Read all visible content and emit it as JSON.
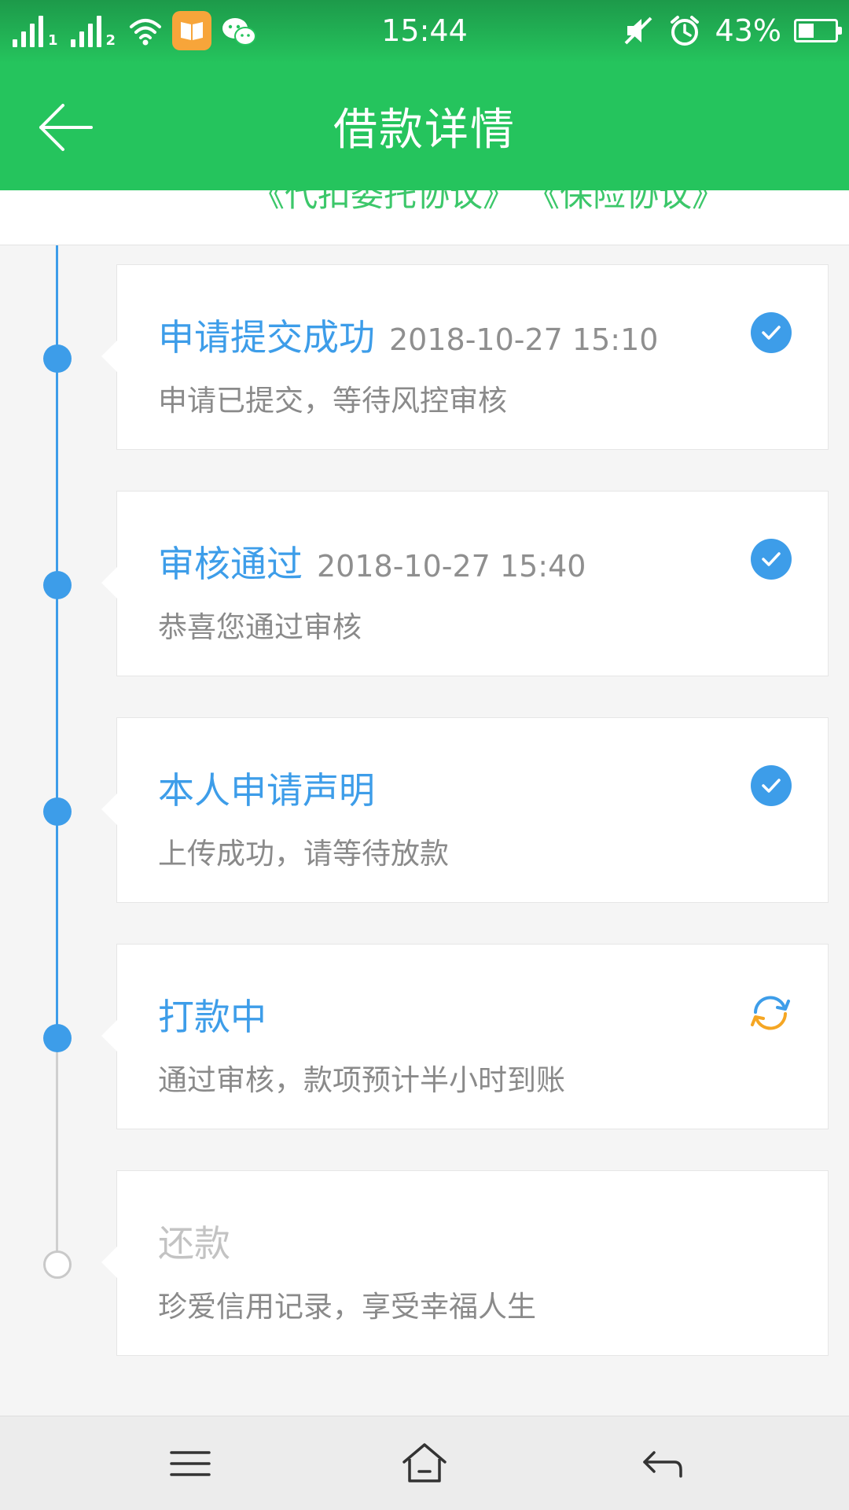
{
  "status_bar": {
    "sim1": "1",
    "sim2": "2",
    "time": "15:44",
    "battery_percent": "43%",
    "battery_level": 0.43
  },
  "header": {
    "title": "借款详情"
  },
  "agreements": {
    "items": [
      "《代扣委托协议》",
      "《保险协议》"
    ]
  },
  "timeline": {
    "steps": [
      {
        "title": "申请提交成功",
        "time": "2018-10-27 15:10",
        "desc": "申请已提交，等待风控审核",
        "status": "done"
      },
      {
        "title": "审核通过",
        "time": "2018-10-27 15:40",
        "desc": "恭喜您通过审核",
        "status": "done"
      },
      {
        "title": "本人申请声明",
        "time": "",
        "desc": "上传成功，请等待放款",
        "status": "done"
      },
      {
        "title": "打款中",
        "time": "",
        "desc": "通过审核，款项预计半小时到账",
        "status": "in-progress"
      },
      {
        "title": "还款",
        "time": "",
        "desc": "珍爱信用记录，享受幸福人生",
        "status": "pending"
      }
    ]
  },
  "icons": {
    "back": "arrow-left-icon",
    "done": "check-circle-icon",
    "in_progress": "refresh-icon",
    "nav_menu": "menu-icon",
    "nav_home": "home-icon",
    "nav_back": "back-icon"
  },
  "colors": {
    "header_green": "#25c45d",
    "step_blue": "#3d9de9",
    "progress_orange": "#f5a623",
    "pending_gray": "#c3c3c3"
  }
}
